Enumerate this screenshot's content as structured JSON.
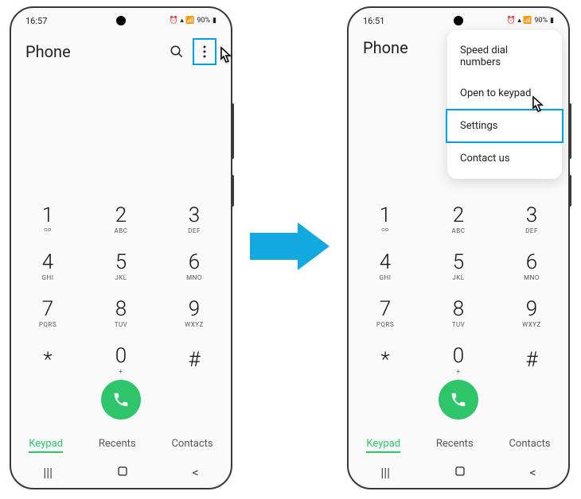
{
  "status": {
    "time_left": "16:57",
    "time_right": "16:51",
    "battery": "90%"
  },
  "header": {
    "title": "Phone"
  },
  "keypad": [
    {
      "num": "1",
      "sub": "ᴼᴼ"
    },
    {
      "num": "2",
      "sub": "ABC"
    },
    {
      "num": "3",
      "sub": "DEF"
    },
    {
      "num": "4",
      "sub": "GHI"
    },
    {
      "num": "5",
      "sub": "JKL"
    },
    {
      "num": "6",
      "sub": "MNO"
    },
    {
      "num": "7",
      "sub": "PQRS"
    },
    {
      "num": "8",
      "sub": "TUV"
    },
    {
      "num": "9",
      "sub": "WXYZ"
    },
    {
      "num": "*",
      "sub": ""
    },
    {
      "num": "0",
      "sub": "+"
    },
    {
      "num": "#",
      "sub": ""
    }
  ],
  "tabs": {
    "keypad": "Keypad",
    "recents": "Recents",
    "contacts": "Contacts"
  },
  "menu": {
    "speed": "Speed dial numbers",
    "open": "Open to keypad",
    "settings": "Settings",
    "contact": "Contact us"
  }
}
